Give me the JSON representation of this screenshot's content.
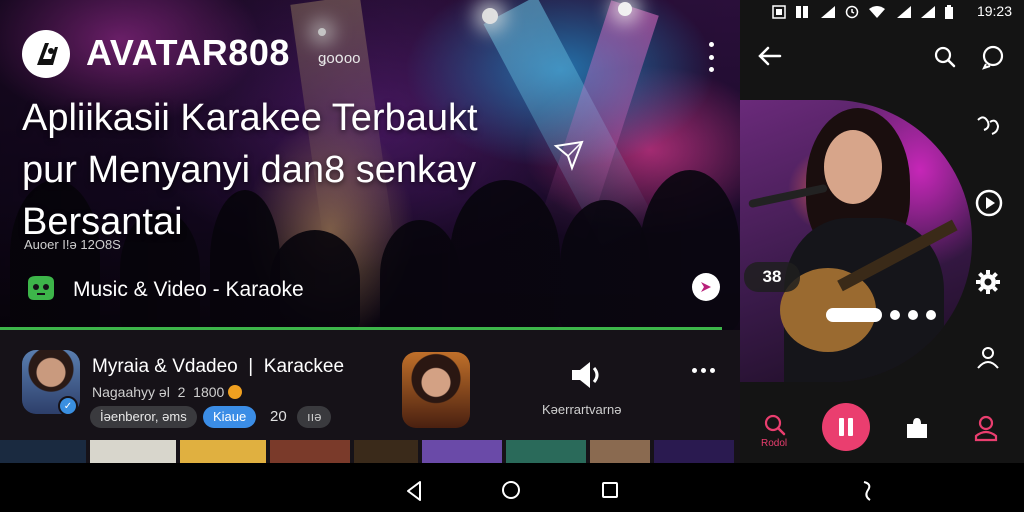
{
  "hero": {
    "brand_name": "AVATAR808",
    "brand_sub": "ǥoօoo",
    "headline_line1": "Apliikasii Karakee Terbaukt",
    "headline_line2": "pur Menyanyi dan8 ѕеnkаy",
    "headline_line3": "Bersantai",
    "meta": "Auoer I!ə 12O8S",
    "category_label": "Music & Video  -   Karaoke",
    "menu_icon": "kebab-menu-icon",
    "share_icon": "play-share-icon",
    "category_icon": "game-controller-icon"
  },
  "card": {
    "title": "Myraia & Vdadeo  |  Karackee",
    "subtitle": "Nagaahyy əl  2  1800",
    "chip_a": "İəenberor, əms",
    "chip_b": "Kiaue",
    "chip_c": "20",
    "chip_d": "ııə",
    "speaker_label": "Kəerrartvarnə",
    "more_icon": "more-horizontal-icon",
    "speaker_icon": "speaker-icon"
  },
  "player": {
    "status_time": "19:23",
    "lyric_badge": "38",
    "nav_search_label": "Rodol",
    "accent": "#ea3e6f"
  },
  "colors": {
    "accent_pink": "#ea3e6f",
    "accent_blue": "#3b8de6",
    "progress_green": "#3db54a",
    "panel_bg": "#141414"
  },
  "strip_colors": [
    "#2a4a6a",
    "#d8d8d0",
    "#e0b040",
    "#b02a2a",
    "#3a3a4a",
    "#6a4aa8",
    "#2a6a5a",
    "#8a6a50",
    "#c03070",
    "#1a2a50"
  ]
}
